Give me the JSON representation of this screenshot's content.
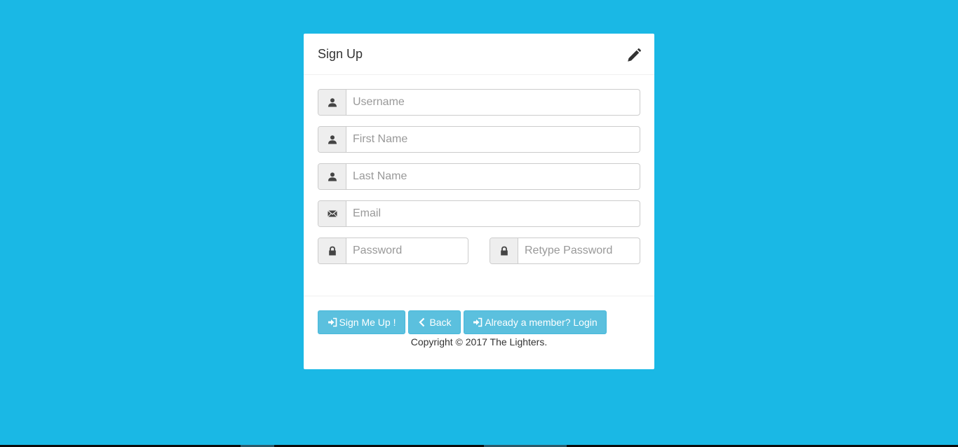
{
  "form": {
    "title": "Sign Up",
    "header_icon": "pencil-icon",
    "fields": {
      "username": {
        "placeholder": "Username",
        "icon": "user-icon"
      },
      "first_name": {
        "placeholder": "First Name",
        "icon": "user-icon"
      },
      "last_name": {
        "placeholder": "Last Name",
        "icon": "user-icon"
      },
      "email": {
        "placeholder": "Email",
        "icon": "envelope-icon"
      },
      "password": {
        "placeholder": "Password",
        "icon": "lock-icon"
      },
      "retype_password": {
        "placeholder": "Retype Password",
        "icon": "lock-icon"
      }
    },
    "buttons": {
      "sign_up": "Sign Me Up !",
      "back": "Back",
      "login": "Already a member? Login"
    },
    "copyright": "Copyright © 2017 The Lighters."
  },
  "colors": {
    "background": "#1ab8e5",
    "button": "#5bc0de",
    "panel": "#ffffff"
  }
}
